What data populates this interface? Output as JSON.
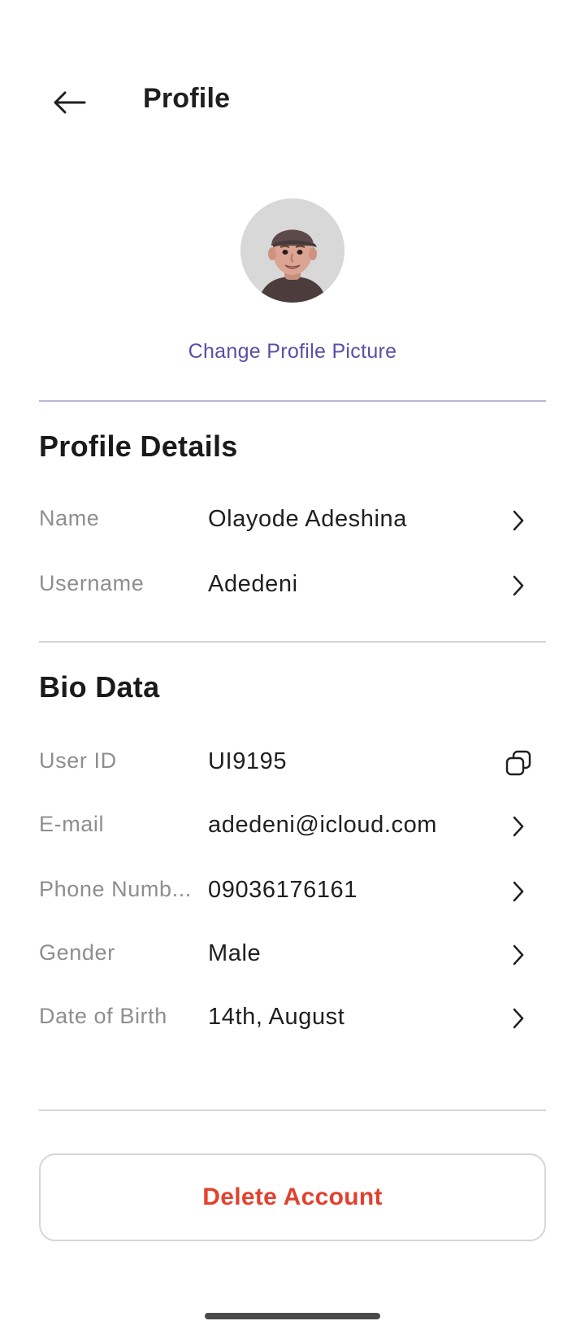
{
  "header": {
    "title": "Profile"
  },
  "profile": {
    "change_picture_label": "Change Profile Picture"
  },
  "profile_details": {
    "title": "Profile Details",
    "rows": [
      {
        "label": "Name",
        "value": "Olayode Adeshina",
        "icon": "chevron-right-icon"
      },
      {
        "label": "Username",
        "value": "Adedeni",
        "icon": "chevron-right-icon"
      }
    ]
  },
  "bio_data": {
    "title": "Bio Data",
    "rows": [
      {
        "label": "User ID",
        "value": "UI9195",
        "icon": "copy-icon"
      },
      {
        "label": "E-mail",
        "value": "adedeni@icloud.com",
        "icon": "chevron-right-icon"
      },
      {
        "label": "Phone Numb...",
        "value": "09036176161",
        "icon": "chevron-right-icon"
      },
      {
        "label": "Gender",
        "value": "Male",
        "icon": "chevron-right-icon"
      },
      {
        "label": "Date of Birth",
        "value": "14th, August",
        "icon": "chevron-right-icon"
      }
    ]
  },
  "actions": {
    "delete_label": "Delete Account"
  },
  "colors": {
    "accent": "#5b4ea6",
    "danger": "#e2412f",
    "label_grey": "#8e8e8e",
    "divider_purple": "#b9b5d9"
  }
}
